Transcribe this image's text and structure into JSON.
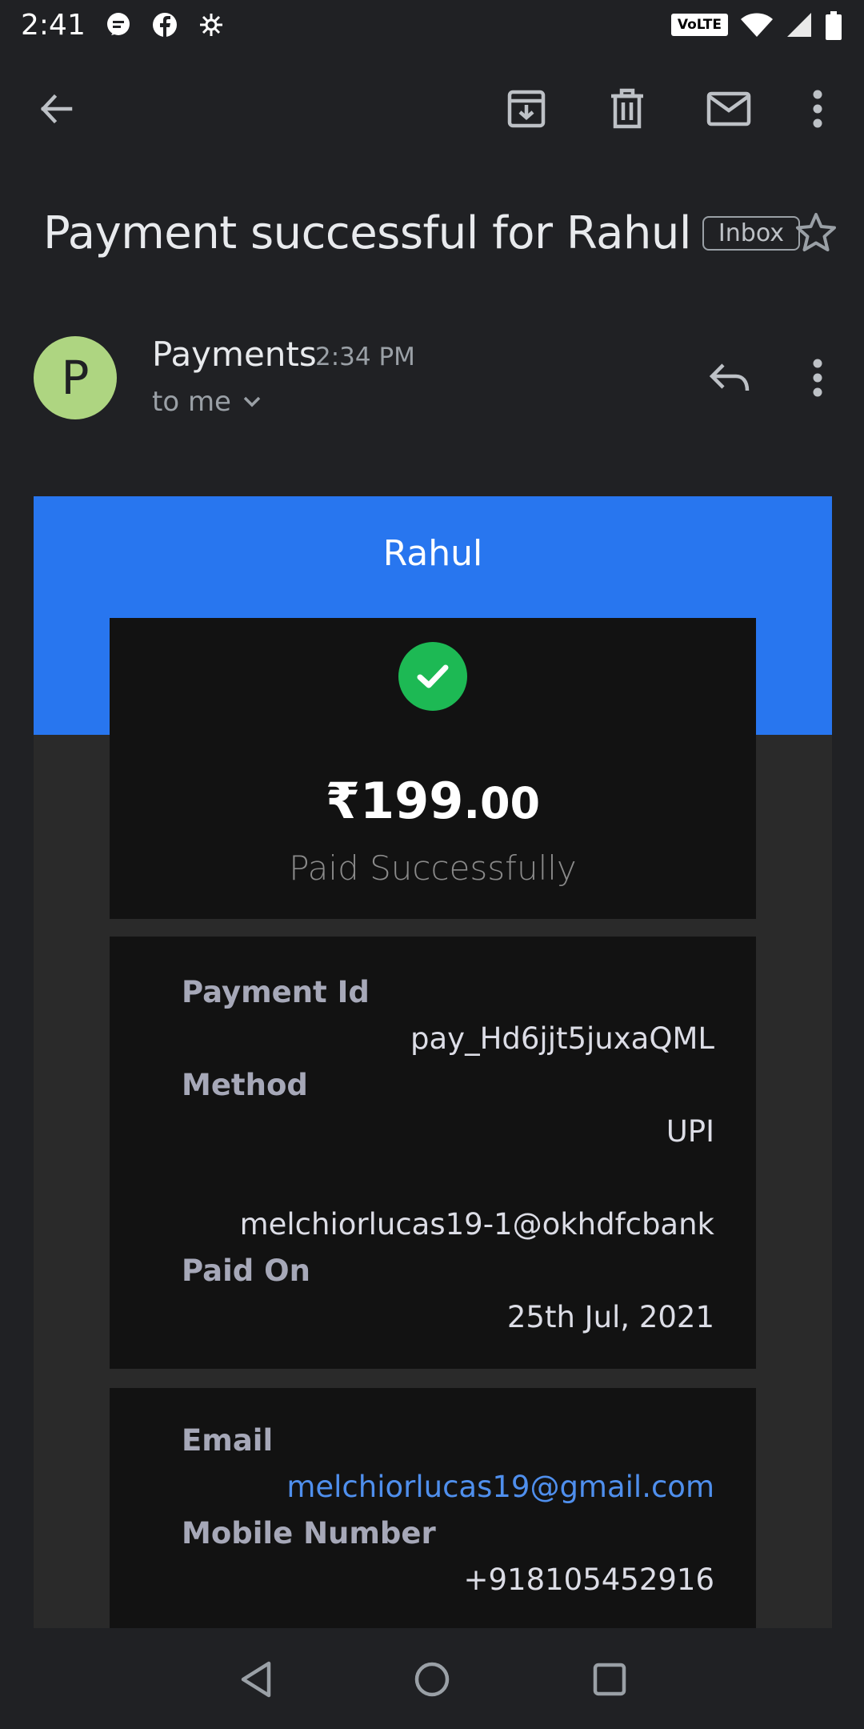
{
  "status_bar": {
    "time": "2:41",
    "volte": "VoLTE",
    "icons": [
      "messaging-icon",
      "facebook-icon",
      "cult-icon",
      "wifi-icon",
      "signal-icon",
      "battery-icon"
    ]
  },
  "toolbar": {
    "icons": [
      "back-arrow-icon",
      "archive-icon",
      "trash-icon",
      "mark-unread-icon",
      "more-vert-icon"
    ]
  },
  "email": {
    "subject": "Payment successful for Rahul",
    "label": "Inbox",
    "sender": {
      "avatar_letter": "P",
      "name": "Payments",
      "time": "2:34 PM",
      "recipient": "to me"
    }
  },
  "receipt": {
    "header_name": "Rahul",
    "amount_main": "₹199",
    "amount_decimal": ".00",
    "status": "Paid Successfully",
    "details": {
      "payment_id_label": "Payment Id",
      "payment_id_value": "pay_Hd6jjt5juxaQML",
      "method_label": "Method",
      "method_value": "UPI",
      "upi_id": "melchiorlucas19-1@okhdfcbank",
      "paid_on_label": "Paid On",
      "paid_on_value": "25th Jul, 2021"
    },
    "contact": {
      "email_label": "Email",
      "email_value": "melchiorlucas19@gmail.com",
      "mobile_label": "Mobile Number",
      "mobile_value": "+918105452916"
    }
  },
  "colors": {
    "background": "#202124",
    "header_blue": "#2876ef",
    "card": "#121212",
    "success_green": "#1db954",
    "avatar_green": "#aed581",
    "link_blue": "#4f8fed"
  }
}
